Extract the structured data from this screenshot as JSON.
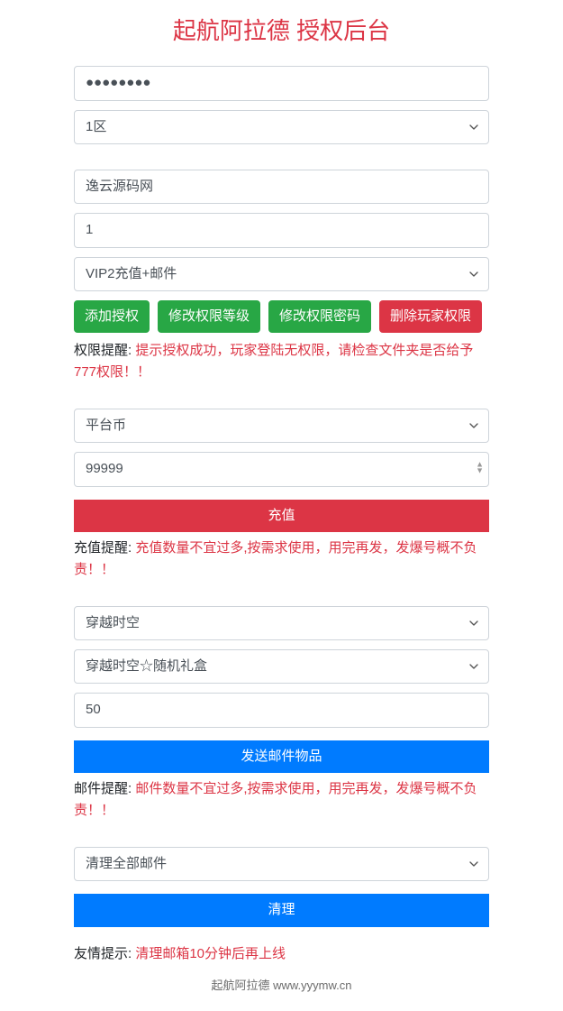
{
  "title": "起航阿拉德 授权后台",
  "section1": {
    "password_value": "●●●●●●●●",
    "zone_select": "1区"
  },
  "section2": {
    "name_value": "逸云源码网",
    "number_value": "1",
    "vip_select": "VIP2充值+邮件",
    "btn_add": "添加授权",
    "btn_modify_level": "修改权限等级",
    "btn_modify_pass": "修改权限密码",
    "btn_delete": "删除玩家权限",
    "hint_label": "权限提醒:",
    "hint_text": "提示授权成功，玩家登陆无权限，请检查文件夹是否给予777权限！！"
  },
  "section3": {
    "currency_select": "平台币",
    "amount_value": "99999",
    "btn_recharge": "充值",
    "hint_label": "充值提醒:",
    "hint_text": "充值数量不宜过多,按需求使用，用完再发，发爆号概不负责！！"
  },
  "section4": {
    "category_select": "穿越时空",
    "item_select": "穿越时空☆随机礼盒",
    "qty_value": "50",
    "btn_send": "发送邮件物品",
    "hint_label": "邮件提醒:",
    "hint_text": "邮件数量不宜过多,按需求使用，用完再发，发爆号概不负责！！"
  },
  "section5": {
    "clear_select": "清理全部邮件",
    "btn_clear": "清理",
    "hint_label": "友情提示:",
    "hint_text": "清理邮箱10分钟后再上线"
  },
  "footer": "起航阿拉德 www.yyymw.cn"
}
